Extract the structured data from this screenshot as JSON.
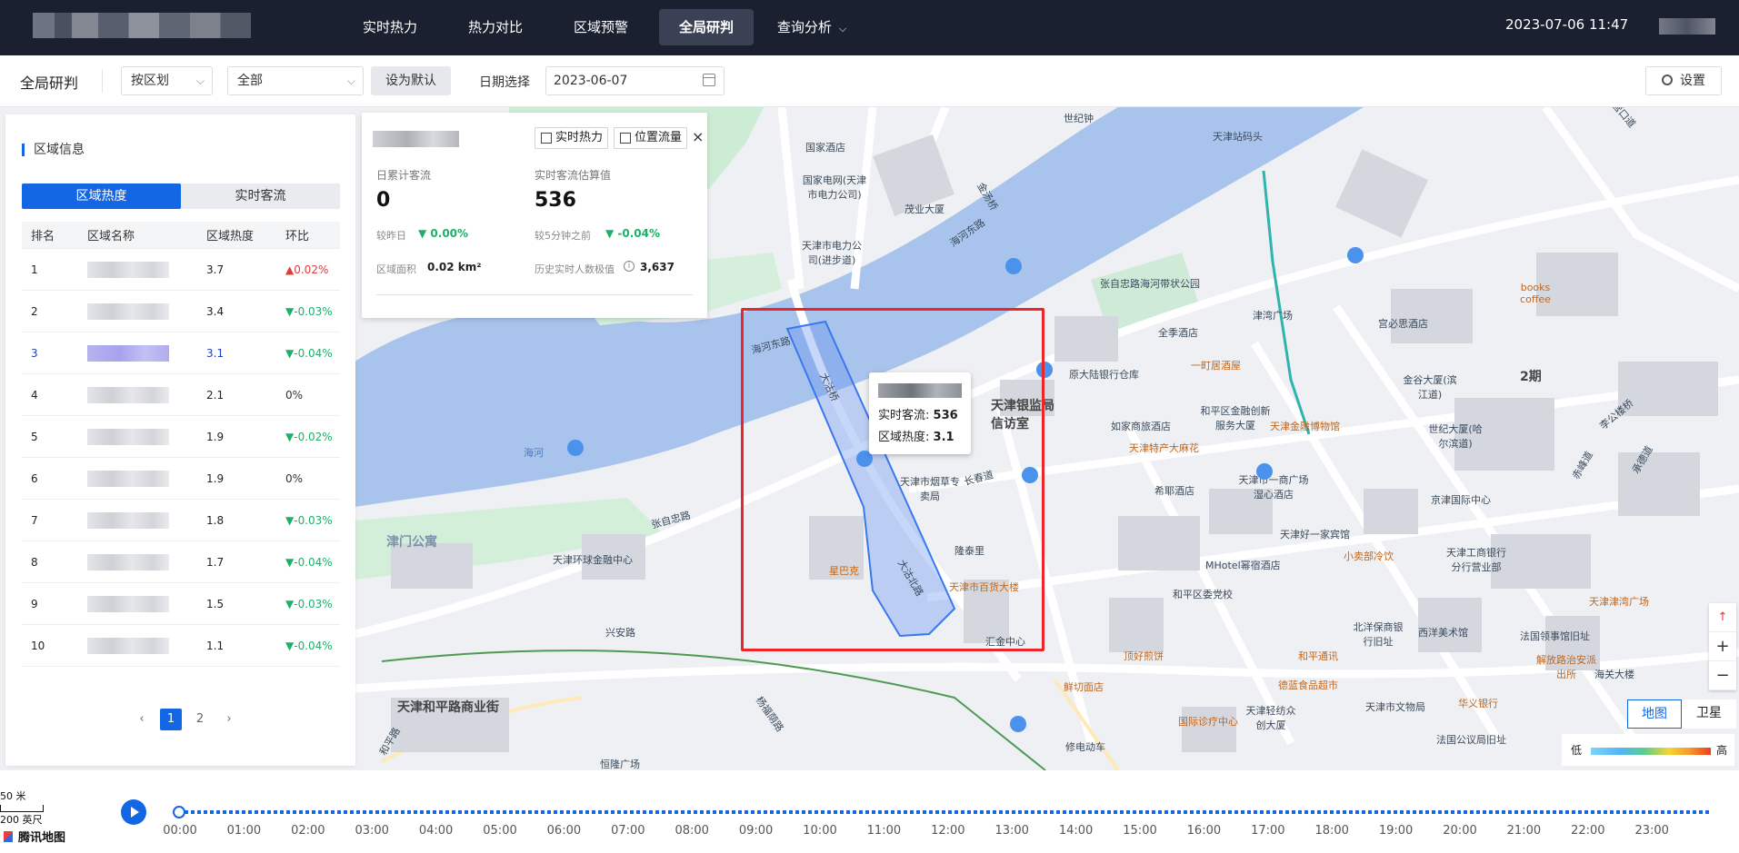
{
  "nav": {
    "items": [
      "实时热力",
      "热力对比",
      "区域预警",
      "全局研判",
      "查询分析"
    ],
    "active": "全局研判",
    "datetime": "2023-07-06 11:47"
  },
  "toolbar": {
    "title": "全局研判",
    "division_select": "按区划",
    "scope_select": "全部",
    "set_default_label": "设为默认",
    "date_label": "日期选择",
    "date_value": "2023-06-07",
    "settings_label": "设置"
  },
  "left_panel": {
    "title": "区域信息",
    "tabs": [
      "区域热度",
      "实时客流"
    ],
    "active_tab": "区域热度",
    "headers": [
      "排名",
      "区域名称",
      "区域热度",
      "环比"
    ],
    "rows": [
      {
        "rank": "1",
        "heat": "3.7",
        "change": "0.02%",
        "dir": "up"
      },
      {
        "rank": "2",
        "heat": "3.4",
        "change": "-0.03%",
        "dir": "down"
      },
      {
        "rank": "3",
        "heat": "3.1",
        "change": "-0.04%",
        "dir": "down",
        "highlight": true
      },
      {
        "rank": "4",
        "heat": "2.1",
        "change": "0%",
        "dir": "flat"
      },
      {
        "rank": "5",
        "heat": "1.9",
        "change": "-0.02%",
        "dir": "down"
      },
      {
        "rank": "6",
        "heat": "1.9",
        "change": "0%",
        "dir": "flat"
      },
      {
        "rank": "7",
        "heat": "1.8",
        "change": "-0.03%",
        "dir": "down"
      },
      {
        "rank": "8",
        "heat": "1.7",
        "change": "-0.04%",
        "dir": "down"
      },
      {
        "rank": "9",
        "heat": "1.5",
        "change": "-0.03%",
        "dir": "down"
      },
      {
        "rank": "10",
        "heat": "1.1",
        "change": "-0.04%",
        "dir": "down"
      }
    ],
    "pager": {
      "prev": "‹",
      "pages": [
        "1",
        "2"
      ],
      "next": "›"
    }
  },
  "info_card": {
    "btn_realtime_heat": "实时热力",
    "btn_position_flow": "位置流量",
    "close": "×",
    "daily_label": "日累计客流",
    "daily_value": "0",
    "realtime_label": "实时客流估算值",
    "realtime_value": "536",
    "vs_yesterday_label": "较昨日",
    "vs_yesterday": "0.00%",
    "vs_5min_label": "较5分钟之前",
    "vs_5min": "-0.04%",
    "area_label": "区域面积",
    "area_value": "0.02 km²",
    "peak_label": "历史实时人数极值",
    "peak_value": "3,637"
  },
  "map_tip": {
    "flow_label": "实时客流:",
    "flow_value": "536",
    "heat_label": "区域热度:",
    "heat_value": "3.1"
  },
  "map": {
    "labels": [
      "海河东路",
      "大沽桥",
      "大沽北路",
      "海河",
      "张自忠路",
      "津门公寓",
      "天津环球金融中心",
      "兴安路",
      "天津和平路商业街",
      "和平路",
      "杨福荫路",
      "恒隆广场",
      "张自忠路海河带状公园",
      "金汤桥",
      "津湾广场",
      "天津银监局信访室",
      "原大陆银行仓库",
      "一町居酒屋",
      "全季酒店",
      "如家商旅酒店",
      "和平区金融创新服务大厦",
      "天津金融博物馆",
      "天津特产大麻花",
      "希耶酒店",
      "天津市烟草专卖局",
      "长春道",
      "隆泰里",
      "星巴克",
      "天津市百货大楼",
      "天津市电力公司(进步道)",
      "国家电网(天津市电力公司)",
      "茂业大厦",
      "世纪钟",
      "海河东路",
      "天津站码头",
      "books coffee",
      "金谷大厦(滨江道)",
      "世纪大厦(哈尔滨道)",
      "京津国际中心",
      "天津市一商广场湿心酒店",
      "和平区委党校",
      "MHotel幂宿酒店",
      "小卖部冷饮",
      "天津工商银行分行营业部",
      "天津津湾广场",
      "天津好一家宾馆",
      "汇金中心",
      "鲜切面店",
      "顶好煎饼",
      "和平通讯",
      "德蓝食品超市",
      "国际诊疗中心",
      "天津轻纺众创大厦",
      "天津市文物局",
      "华义银行",
      "北洋保商银行旧址",
      "西洋美术馆",
      "法国领事馆旧址",
      "解放路治安派出所",
      "法国公议局旧址",
      "修电动车",
      "2期",
      "宫必思酒店",
      "海关大楼",
      "营口道",
      "承德道",
      "赤峰道",
      "李公楼桥",
      "国家酒店"
    ],
    "scale_50m": "50 米",
    "scale_200ft": "200 英尺",
    "provider": "腾讯地图",
    "controls": [
      "+",
      "−"
    ],
    "map_types": [
      "地图",
      "卫星"
    ],
    "active_map_type": "地图",
    "legend_low": "低",
    "legend_high": "高"
  },
  "timeline": {
    "hours": [
      "00:00",
      "01:00",
      "02:00",
      "03:00",
      "04:00",
      "05:00",
      "06:00",
      "07:00",
      "08:00",
      "09:00",
      "10:00",
      "11:00",
      "12:00",
      "13:00",
      "14:00",
      "15:00",
      "16:00",
      "17:00",
      "18:00",
      "19:00",
      "20:00",
      "21:00",
      "22:00",
      "23:00"
    ],
    "current": "00:00"
  },
  "colors": {
    "accent": "#1366e4",
    "nav_bg": "#1b2031",
    "up": "#e03b3b",
    "down": "#1bb169",
    "highlight_box": "#e8262b"
  }
}
